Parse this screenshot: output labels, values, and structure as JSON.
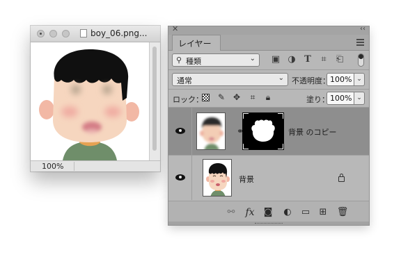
{
  "document_window": {
    "title": "boy_06.png...",
    "zoom": "100%",
    "file_icon": "document-icon"
  },
  "layers_panel": {
    "tab_label": "レイヤー",
    "filter": {
      "search_icon": "search-icon",
      "kind_label": "種類",
      "icons": [
        "image-filter-icon",
        "adjustment-filter-icon",
        "type-filter-icon",
        "shape-filter-icon",
        "smart-object-filter-icon",
        "filter-toggle-icon"
      ]
    },
    "blend_mode": "通常",
    "opacity_label": "不透明度：",
    "opacity_value": "100%",
    "lock_label": "ロック：",
    "lock_icons": [
      "lock-transparent-pixels-icon",
      "lock-image-pixels-icon",
      "lock-position-icon",
      "lock-artboard-icon",
      "lock-all-icon"
    ],
    "fill_label": "塗り：",
    "fill_value": "100%",
    "layers": [
      {
        "name": "背景 のコピー",
        "selected": true,
        "visible": true,
        "has_mask": true,
        "locked": false
      },
      {
        "name": "背景",
        "selected": false,
        "visible": true,
        "has_mask": false,
        "locked": true
      }
    ],
    "bottom_icons": [
      "link-layers-icon",
      "layer-style-fx-icon",
      "add-mask-icon",
      "adjustment-layer-icon",
      "new-group-icon",
      "new-layer-icon",
      "delete-layer-icon"
    ],
    "fx_label": "fx",
    "colors": {
      "panel_bg": "#b8b8b8",
      "selected_row": "#8e8e8e",
      "row_bg": "#b8b8b8"
    }
  }
}
